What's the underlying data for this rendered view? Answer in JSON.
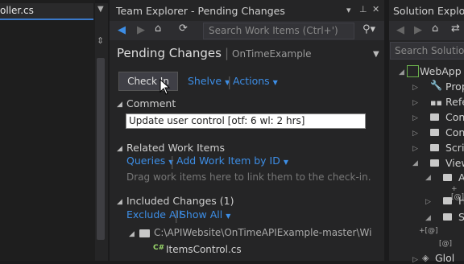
{
  "left_editor": {
    "tab_label": "oller.cs"
  },
  "team_explorer": {
    "title": "Team Explorer - Pending Changes",
    "search_placeholder": "Search Work Items (Ctrl+')",
    "header": "Pending Changes",
    "project": "OnTimeExample",
    "check_in_label": "Check In",
    "shelve_label": "Shelve",
    "actions_label": "Actions",
    "comment_section": "Comment",
    "comment_value": "Update user control [otf: 6 wl: 2 hrs]",
    "related_section": "Related Work Items",
    "queries_label": "Queries",
    "add_work_item_label": "Add Work Item by ID",
    "drag_hint": "Drag work items here to link them to the check-in.",
    "included_section": "Included Changes (1)",
    "exclude_all_label": "Exclude All",
    "show_all_label": "Show All",
    "path": "C:\\APIWebsite\\OnTimeAPIExample-master\\WinA...",
    "file": "ItemsControl.cs",
    "file_badge": "C#"
  },
  "solution_explorer": {
    "title": "Solution Explorer",
    "search_placeholder": "Search Solution E",
    "items": [
      "WebApp",
      "Prop",
      "Refe",
      "Con",
      "Con",
      "Scrip",
      "View",
      "A",
      "H",
      "S",
      "Glol"
    ]
  },
  "colors": {
    "accent": "#3d8ee6",
    "background": "#252526",
    "editor": "#1e1e1e"
  }
}
